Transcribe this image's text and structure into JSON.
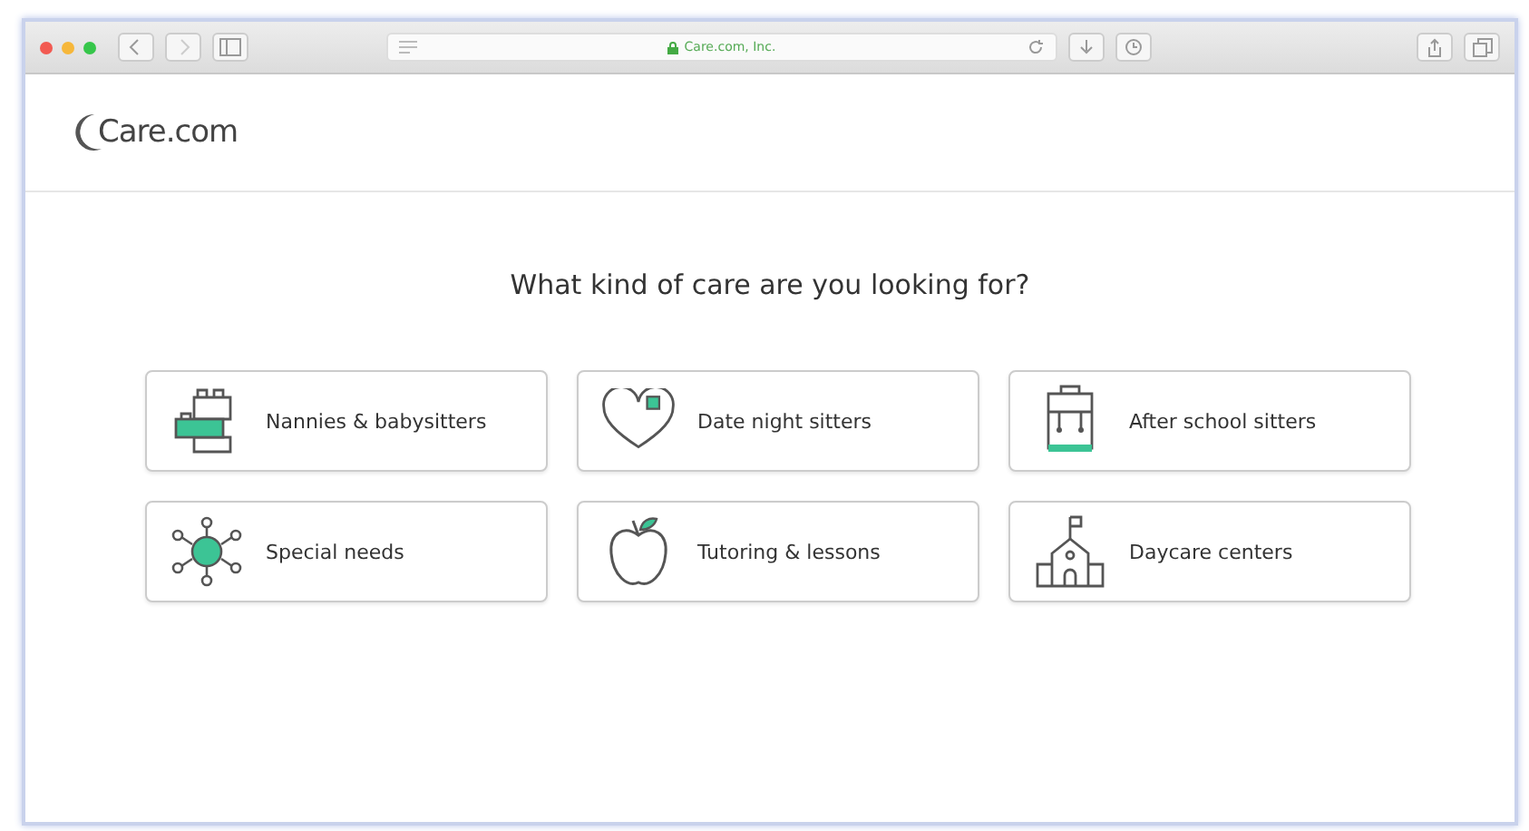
{
  "browser": {
    "address": "Care.com, Inc."
  },
  "header": {
    "logo": "Care.com"
  },
  "heading": "What kind of care are you looking for?",
  "options": [
    {
      "label": "Nannies & babysitters"
    },
    {
      "label": "Date night sitters"
    },
    {
      "label": "After school sitters"
    },
    {
      "label": "Special needs"
    },
    {
      "label": "Tutoring & lessons"
    },
    {
      "label": "Daycare centers"
    }
  ]
}
